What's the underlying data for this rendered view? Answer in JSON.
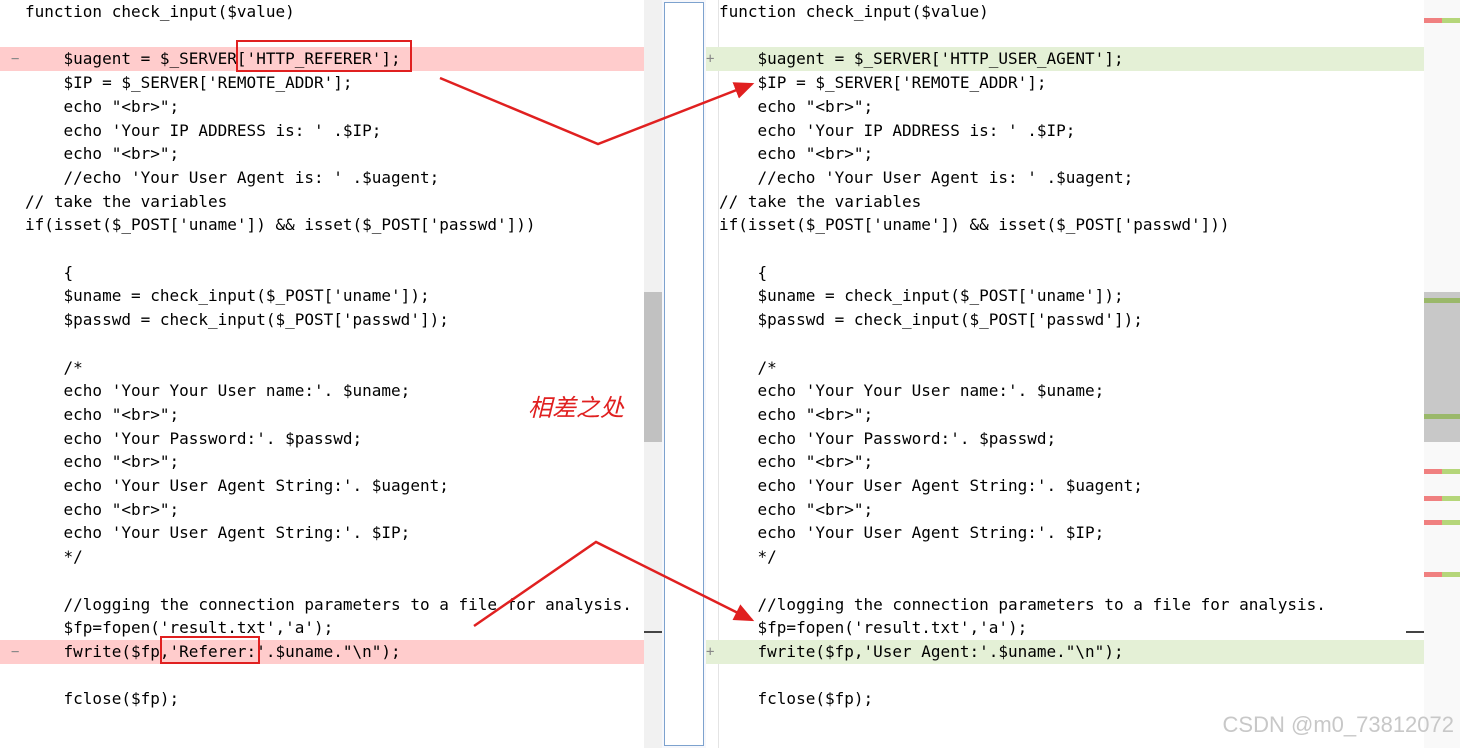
{
  "left": {
    "lines": [
      {
        "type": "normal",
        "code": "function check_input($value)"
      },
      {
        "type": "normal",
        "code": ""
      },
      {
        "type": "del",
        "code": "    $uagent = $_SERVER['HTTP_REFERER'];"
      },
      {
        "type": "normal",
        "code": "    $IP = $_SERVER['REMOTE_ADDR'];"
      },
      {
        "type": "normal",
        "code": "    echo \"<br>\";"
      },
      {
        "type": "normal",
        "code": "    echo 'Your IP ADDRESS is: ' .$IP;"
      },
      {
        "type": "normal",
        "code": "    echo \"<br>\";"
      },
      {
        "type": "normal",
        "code": "    //echo 'Your User Agent is: ' .$uagent;"
      },
      {
        "type": "normal",
        "code": "// take the variables"
      },
      {
        "type": "normal",
        "code": "if(isset($_POST['uname']) && isset($_POST['passwd']))"
      },
      {
        "type": "normal",
        "code": ""
      },
      {
        "type": "normal",
        "code": "    {"
      },
      {
        "type": "normal",
        "code": "    $uname = check_input($_POST['uname']);"
      },
      {
        "type": "normal",
        "code": "    $passwd = check_input($_POST['passwd']);"
      },
      {
        "type": "normal",
        "code": ""
      },
      {
        "type": "normal",
        "code": "    /*"
      },
      {
        "type": "normal",
        "code": "    echo 'Your Your User name:'. $uname;"
      },
      {
        "type": "normal",
        "code": "    echo \"<br>\";"
      },
      {
        "type": "normal",
        "code": "    echo 'Your Password:'. $passwd;"
      },
      {
        "type": "normal",
        "code": "    echo \"<br>\";"
      },
      {
        "type": "normal",
        "code": "    echo 'Your User Agent String:'. $uagent;"
      },
      {
        "type": "normal",
        "code": "    echo \"<br>\";"
      },
      {
        "type": "normal",
        "code": "    echo 'Your User Agent String:'. $IP;"
      },
      {
        "type": "normal",
        "code": "    */"
      },
      {
        "type": "normal",
        "code": ""
      },
      {
        "type": "normal",
        "code": "    //logging the connection parameters to a file for analysis."
      },
      {
        "type": "normal",
        "code": "    $fp=fopen('result.txt','a');"
      },
      {
        "type": "del",
        "code": "    fwrite($fp,'Referer:'.$uname.\"\\n\");"
      },
      {
        "type": "normal",
        "code": ""
      },
      {
        "type": "normal",
        "code": "    fclose($fp);"
      }
    ]
  },
  "right": {
    "lines": [
      {
        "type": "normal",
        "code": "function check_input($value)"
      },
      {
        "type": "normal",
        "code": ""
      },
      {
        "type": "add",
        "code": "    $uagent = $_SERVER['HTTP_USER_AGENT'];"
      },
      {
        "type": "normal",
        "code": "    $IP = $_SERVER['REMOTE_ADDR'];"
      },
      {
        "type": "normal",
        "code": "    echo \"<br>\";"
      },
      {
        "type": "normal",
        "code": "    echo 'Your IP ADDRESS is: ' .$IP;"
      },
      {
        "type": "normal",
        "code": "    echo \"<br>\";"
      },
      {
        "type": "normal",
        "code": "    //echo 'Your User Agent is: ' .$uagent;"
      },
      {
        "type": "normal",
        "code": "// take the variables"
      },
      {
        "type": "normal",
        "code": "if(isset($_POST['uname']) && isset($_POST['passwd']))"
      },
      {
        "type": "normal",
        "code": ""
      },
      {
        "type": "normal",
        "code": "    {"
      },
      {
        "type": "normal",
        "code": "    $uname = check_input($_POST['uname']);"
      },
      {
        "type": "normal",
        "code": "    $passwd = check_input($_POST['passwd']);"
      },
      {
        "type": "normal",
        "code": ""
      },
      {
        "type": "normal",
        "code": "    /*"
      },
      {
        "type": "normal",
        "code": "    echo 'Your Your User name:'. $uname;"
      },
      {
        "type": "normal",
        "code": "    echo \"<br>\";"
      },
      {
        "type": "normal",
        "code": "    echo 'Your Password:'. $passwd;"
      },
      {
        "type": "normal",
        "code": "    echo \"<br>\";"
      },
      {
        "type": "normal",
        "code": "    echo 'Your User Agent String:'. $uagent;"
      },
      {
        "type": "normal",
        "code": "    echo \"<br>\";"
      },
      {
        "type": "normal",
        "code": "    echo 'Your User Agent String:'. $IP;"
      },
      {
        "type": "normal",
        "code": "    */"
      },
      {
        "type": "normal",
        "code": ""
      },
      {
        "type": "normal",
        "code": "    //logging the connection parameters to a file for analysis."
      },
      {
        "type": "normal",
        "code": "    $fp=fopen('result.txt','a');"
      },
      {
        "type": "add",
        "code": "    fwrite($fp,'User Agent:'.$uname.\"\\n\");"
      },
      {
        "type": "normal",
        "code": ""
      },
      {
        "type": "normal",
        "code": "    fclose($fp);"
      }
    ]
  },
  "markers": {
    "deleted": "−",
    "added": "+"
  },
  "annotation": {
    "label": "相差之处"
  },
  "watermark": "CSDN @m0_73812072",
  "colors": {
    "deleted_bg": "#ffcccc",
    "added_bg": "#e4f0d6",
    "annotation_red": "#e02020",
    "keyword_blue": "#0000ff",
    "string_red": "#a31515"
  }
}
